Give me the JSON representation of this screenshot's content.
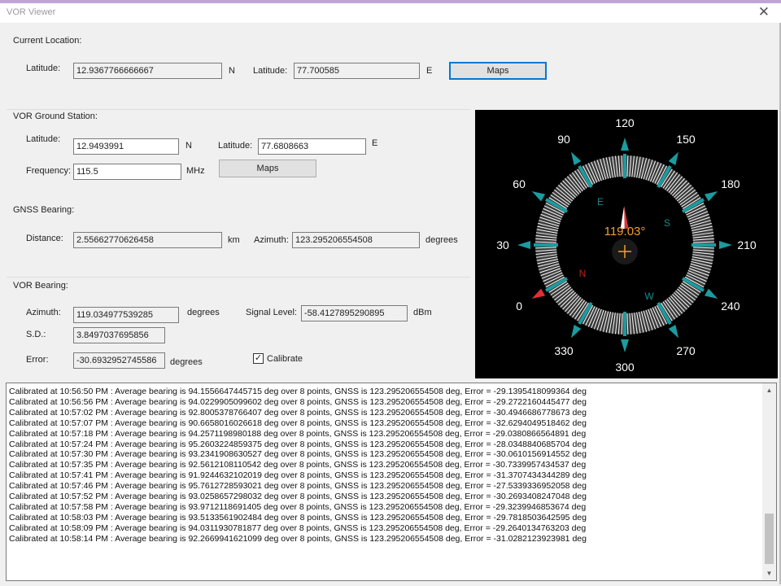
{
  "window": {
    "title": "VOR Viewer",
    "close_glyph": "✕"
  },
  "current_location": {
    "group_label": "Current Location:",
    "lat_label": "Latitude:",
    "lat_value": "12.9367766666667",
    "lat_hemi": "N",
    "lon_label": "Latitude:",
    "lon_value": "77.700585",
    "lon_hemi": "E",
    "maps_label": "Maps"
  },
  "vor_station": {
    "group_label": "VOR Ground Station:",
    "lat_label": "Latitude:",
    "lat_value": "12.9493991",
    "lat_hemi": "N",
    "lon_label": "Latitude:",
    "lon_value": "77.6808663",
    "lon_hemi": "E",
    "freq_label": "Frequency:",
    "freq_value": "115.5",
    "freq_unit": "MHz",
    "maps_label": "Maps"
  },
  "gnss_bearing": {
    "group_label": "GNSS Bearing:",
    "distance_label": "Distance:",
    "distance_value": "2.55662770626458",
    "distance_unit": "km",
    "azimuth_label": "Azimuth:",
    "azimuth_value": "123.295206554508",
    "azimuth_unit": "degrees"
  },
  "vor_bearing": {
    "group_label": "VOR Bearing:",
    "azimuth_label": "Azimuth:",
    "azimuth_value": "119.0349775392​85",
    "azimuth_unit": "degrees",
    "signal_label": "Signal Level:",
    "signal_value": "-58.4127895290895",
    "signal_unit": "dBm",
    "sd_label": "S.D.:",
    "sd_value": "3.8497037695856",
    "error_label": "Error:",
    "error_value": "-30.6932952745586",
    "error_unit": "degrees",
    "calibrate_label": "Calibrate",
    "calibrate_checked": "✓"
  },
  "compass": {
    "ticks": [
      "0",
      "30",
      "60",
      "90",
      "120",
      "150",
      "180",
      "210",
      "240",
      "270",
      "300",
      "330"
    ],
    "cardinals": {
      "N": "N",
      "E": "E",
      "S": "S",
      "W": "W"
    },
    "bearing_value": 119.03,
    "bearing_label": "119.03°",
    "colors": {
      "bg": "#000000",
      "ring": "#ffffff",
      "tick": "#1a9ca0",
      "needle": "#e03030",
      "readout": "#f0a030",
      "cardinal_ew": "#1a8a8a",
      "cardinal_n": "#c02020"
    }
  },
  "log": {
    "lines": [
      "Calibrated at 10:56:50 PM : Average bearing is 94.1556647445715 deg over 8 points, GNSS is 123.295206554508 deg, Error = -29.1395418099364 deg",
      "Calibrated at 10:56:56 PM : Average bearing is 94.0229905099602 deg over 8 points, GNSS is 123.295206554508 deg, Error = -29.2722160445477 deg",
      "Calibrated at 10:57:02 PM : Average bearing is 92.8005378766407 deg over 8 points, GNSS is 123.295206554508 deg, Error = -30.4946686778673 deg",
      "Calibrated at 10:57:07 PM : Average bearing is 90.6658016026618 deg over 8 points, GNSS is 123.295206554508 deg, Error = -32.6294049518462 deg",
      "Calibrated at 10:57:18 PM : Average bearing is 94.2571198980188 deg over 8 points, GNSS is 123.295206554508 deg, Error = -29.0380866564891 deg",
      "Calibrated at 10:57:24 PM : Average bearing is 95.2603224859375 deg over 8 points, GNSS is 123.295206554508 deg, Error = -28.0348840685704 deg",
      "Calibrated at 10:57:30 PM : Average bearing is 93.2341908630527 deg over 8 points, GNSS is 123.295206554508 deg, Error = -30.0610156914552 deg",
      "Calibrated at 10:57:35 PM : Average bearing is 92.5612108110542 deg over 8 points, GNSS is 123.295206554508 deg, Error = -30.7339957434537 deg",
      "Calibrated at 10:57:41 PM : Average bearing is 91.9244632102019 deg over 8 points, GNSS is 123.295206554508 deg, Error = -31.3707434344289 deg",
      "Calibrated at 10:57:46 PM : Average bearing is 95.7612728593021 deg over 8 points, GNSS is 123.295206554508 deg, Error = -27.5339336952058 deg",
      "Calibrated at 10:57:52 PM : Average bearing is 93.0258657298032 deg over 8 points, GNSS is 123.295206554508 deg, Error = -30.2693408247048 deg",
      "Calibrated at 10:57:58 PM : Average bearing is 93.9712118691405 deg over 8 points, GNSS is 123.295206554508 deg, Error = -29.3239946853674 deg",
      "Calibrated at 10:58:03 PM : Average bearing is 93.5133561902484 deg over 8 points, GNSS is 123.295206554508 deg, Error = -29.7818503642595 deg",
      "Calibrated at 10:58:09 PM : Average bearing is 94.0311930781877 deg over 8 points, GNSS is 123.295206554508 deg, Error = -29.2640134763203 deg",
      "Calibrated at 10:58:14 PM : Average bearing is 92.2669941621099 deg over 8 points, GNSS is 123.295206554508 deg, Error = -31.0282123923981 deg"
    ],
    "scroll_up": "▲",
    "scroll_down": "▼"
  }
}
